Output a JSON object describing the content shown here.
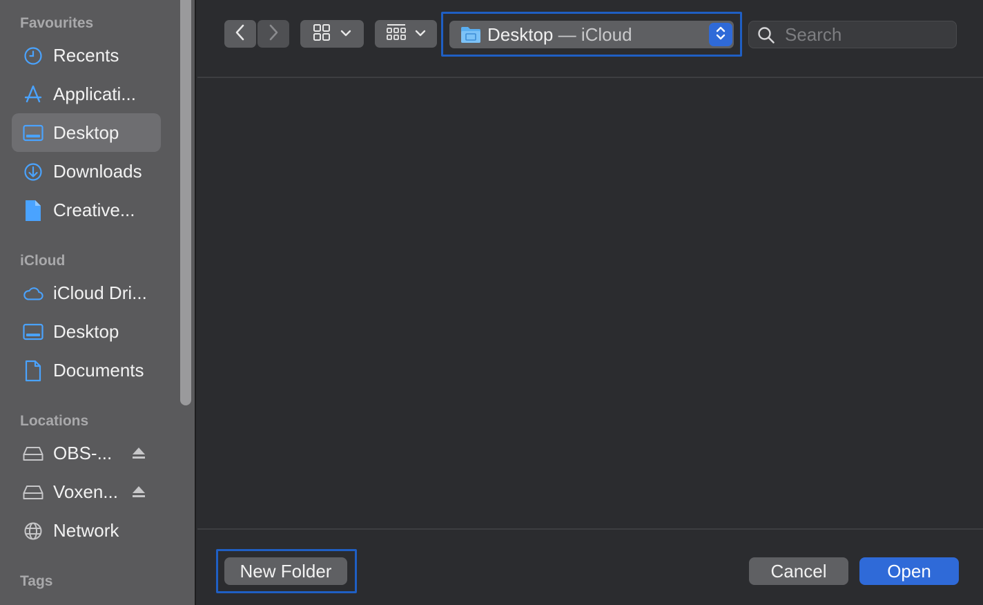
{
  "sidebar": {
    "sections": {
      "favourites": "Favourites",
      "icloud": "iCloud",
      "locations": "Locations",
      "tags": "Tags"
    },
    "favourites": [
      {
        "label": "Recents",
        "icon": "clock-icon"
      },
      {
        "label": "Applicati...",
        "icon": "applications-icon"
      },
      {
        "label": "Desktop",
        "icon": "desktop-icon",
        "selected": true
      },
      {
        "label": "Downloads",
        "icon": "download-icon"
      },
      {
        "label": "Creative...",
        "icon": "document-icon"
      }
    ],
    "icloud": [
      {
        "label": "iCloud Dri...",
        "icon": "cloud-icon"
      },
      {
        "label": "Desktop",
        "icon": "desktop-icon"
      },
      {
        "label": "Documents",
        "icon": "document-icon"
      }
    ],
    "locations": [
      {
        "label": "OBS-...",
        "icon": "drive-icon",
        "eject": true
      },
      {
        "label": "Voxen...",
        "icon": "drive-icon",
        "eject": true
      },
      {
        "label": "Network",
        "icon": "globe-icon"
      }
    ]
  },
  "toolbar": {
    "path": {
      "primary": "Desktop",
      "secondary": " — iCloud"
    },
    "search": {
      "placeholder": "Search"
    }
  },
  "footer": {
    "new_folder": "New Folder",
    "cancel": "Cancel",
    "open": "Open"
  },
  "colors": {
    "accent": "#2f6ad8",
    "highlight": "#1f5fc4",
    "sidebar_icon": "#4aa3ff"
  }
}
